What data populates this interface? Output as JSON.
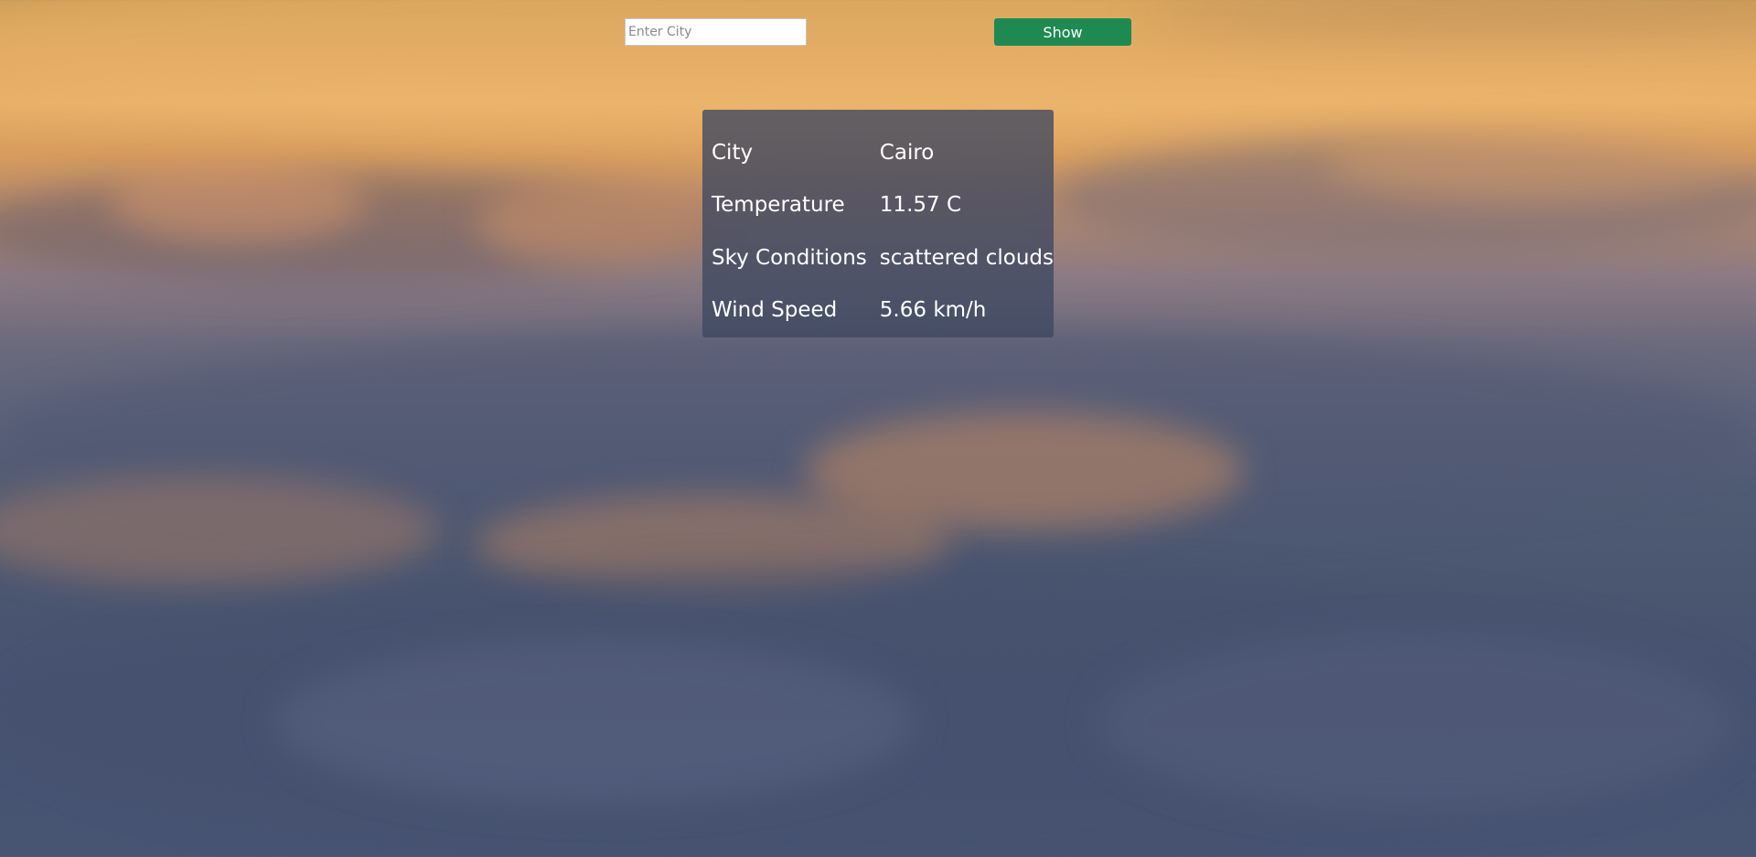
{
  "search": {
    "placeholder": "Enter City",
    "value": ""
  },
  "show_button": {
    "label": "Show",
    "color": "#1e8a52"
  },
  "weather": {
    "rows": [
      {
        "label": "City",
        "value": "Cairo"
      },
      {
        "label": "Temperature",
        "value": "11.57 C"
      },
      {
        "label": "Sky Conditions",
        "value": "scattered clouds"
      },
      {
        "label": "Wind Speed",
        "value": "5.66 km/h"
      }
    ]
  }
}
